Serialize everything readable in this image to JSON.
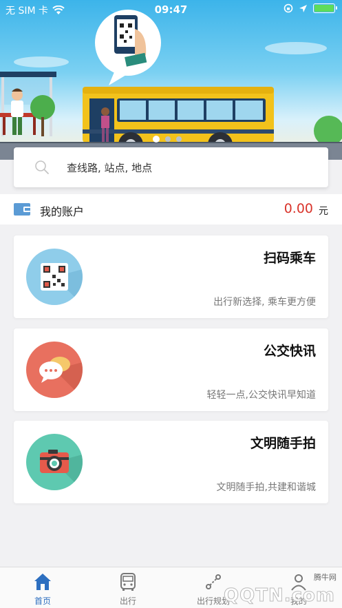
{
  "status_bar": {
    "carrier": "无 SIM 卡",
    "time": "09:47"
  },
  "banner": {
    "carousel_pages": 3,
    "active_page": 1
  },
  "search": {
    "placeholder": "查线路, 站点, 地点"
  },
  "account": {
    "label": "我的账户",
    "amount": "0.00",
    "unit": "元"
  },
  "cards": [
    {
      "title": "扫码乘车",
      "desc": "出行新选择, 乘车更方便",
      "icon": "qr-code-icon",
      "color": "#8fcdea"
    },
    {
      "title": "公交快讯",
      "desc": "轻轻一点,公交快讯早知道",
      "icon": "chat-bubble-icon",
      "color": "#e8705f"
    },
    {
      "title": "文明随手拍",
      "desc": "文明随手拍,共建和谐城",
      "icon": "camera-icon",
      "color": "#5ec9b0"
    }
  ],
  "tabbar": {
    "items": [
      {
        "label": "首页",
        "icon": "home-icon"
      },
      {
        "label": "出行",
        "icon": "bus-icon"
      },
      {
        "label": "出行规划",
        "icon": "route-icon"
      },
      {
        "label": "我的",
        "icon": "profile-icon"
      }
    ]
  },
  "watermark": {
    "top": "腾牛网",
    "big": "QQTN.com"
  },
  "colors": {
    "accent": "#2d6fc0",
    "amount": "#d9342b",
    "sky": "#3cb4ea"
  }
}
